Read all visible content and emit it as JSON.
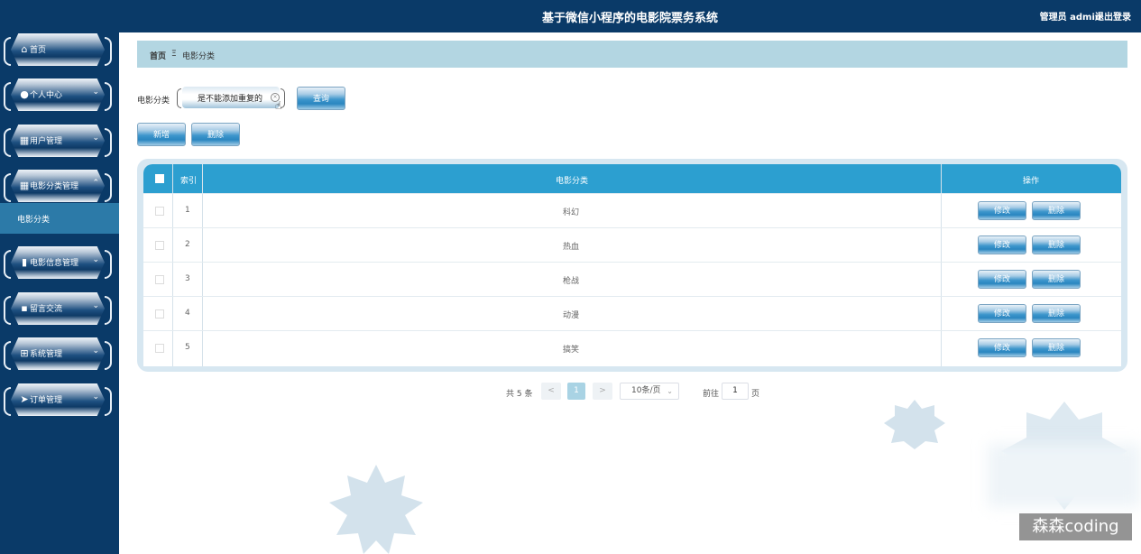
{
  "header": {
    "title": "基于微信小程序的电影院票务系统",
    "admin_label": "管理员 admin",
    "logout_label": "退出登录"
  },
  "sidebar": {
    "items": [
      {
        "label": "首页",
        "icon": "home-icon"
      },
      {
        "label": "个人中心",
        "icon": "user-icon"
      },
      {
        "label": "用户管理",
        "icon": "grid-icon"
      },
      {
        "label": "电影分类管理",
        "icon": "grid-icon"
      },
      {
        "label": "电影信息管理",
        "icon": "film-icon"
      },
      {
        "label": "留言交流",
        "icon": "message-icon"
      },
      {
        "label": "系统管理",
        "icon": "apps-icon"
      },
      {
        "label": "订单管理",
        "icon": "send-icon"
      }
    ],
    "sub_item": "电影分类"
  },
  "breadcrumb": {
    "home": "首页",
    "separator": "Ξ",
    "current": "电影分类"
  },
  "search": {
    "label": "电影分类",
    "value": "是不能添加重复的",
    "button": "查询"
  },
  "actions": {
    "add": "新增",
    "delete": "删除"
  },
  "table": {
    "columns": {
      "index": "索引",
      "category": "电影分类",
      "operation": "操作"
    },
    "edit_label": "修改",
    "delete_label": "删除",
    "rows": [
      {
        "index": "1",
        "category": "科幻"
      },
      {
        "index": "2",
        "category": "热血"
      },
      {
        "index": "3",
        "category": "枪战"
      },
      {
        "index": "4",
        "category": "动漫"
      },
      {
        "index": "5",
        "category": "搞笑"
      }
    ]
  },
  "pagination": {
    "total": "共 5 条",
    "prev": "<",
    "current": "1",
    "next": ">",
    "page_size": "10条/页",
    "goto_label": "前往",
    "goto_value": "1",
    "page_unit": "页"
  },
  "watermark": "森森coding",
  "colors": {
    "sidebar_bg": "#0a3a68",
    "active_sub_bg": "#2c7aa8",
    "breadcrumb_bg": "#b3d6e2",
    "table_header_bg": "#2c9fd0"
  }
}
